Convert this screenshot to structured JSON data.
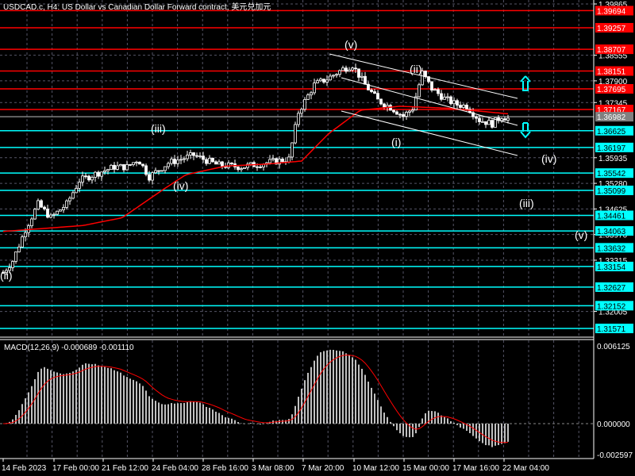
{
  "header": {
    "title": "USDCAD.c, H4:  US Dollar vs Canadian Dollar Forward contract, 美元兑加元"
  },
  "colors": {
    "resistance": "#ff0000",
    "support": "#00ffff",
    "current": "#808080",
    "ma": "#ff0000",
    "candle": "#ffffff",
    "histogram": "#c0c0c0",
    "signal": "#ff0000"
  },
  "chart_data": [
    {
      "type": "candlestick",
      "title": "USDCAD.c, H4",
      "ylim": [
        1.31571,
        1.39865
      ],
      "price_ticks": [
        "1.39865",
        "1.38555",
        "1.37900",
        "1.37345",
        "1.35935",
        "1.35280",
        "1.34625",
        "1.33970",
        "1.33315",
        "1.32005"
      ],
      "resistance_levels": [
        "1.39694",
        "1.39257",
        "1.38707",
        "1.38151",
        "1.37695",
        "1.37167"
      ],
      "current_price": "1.36982",
      "support_levels": [
        "1.36625",
        "1.36197",
        "1.35542",
        "1.35099",
        "1.34461",
        "1.34063",
        "1.33632",
        "1.33154",
        "1.32627",
        "1.32152",
        "1.31571"
      ],
      "close_keypoints": [
        [
          0,
          1.33
        ],
        [
          6,
          1.333
        ],
        [
          14,
          1.341
        ],
        [
          22,
          1.3475
        ],
        [
          30,
          1.344
        ],
        [
          40,
          1.3475
        ],
        [
          48,
          1.3535
        ],
        [
          58,
          1.3552
        ],
        [
          70,
          1.357
        ],
        [
          78,
          1.357
        ],
        [
          85,
          1.359
        ],
        [
          92,
          1.3545
        ],
        [
          104,
          1.358
        ],
        [
          120,
          1.36
        ],
        [
          135,
          1.3575
        ],
        [
          150,
          1.357
        ],
        [
          165,
          1.358
        ],
        [
          180,
          1.359
        ],
        [
          186,
          1.371
        ],
        [
          196,
          1.378
        ],
        [
          204,
          1.3795
        ],
        [
          214,
          1.382
        ],
        [
          220,
          1.383
        ],
        [
          228,
          1.378
        ],
        [
          236,
          1.374
        ],
        [
          245,
          1.372
        ],
        [
          252,
          1.37
        ],
        [
          258,
          1.372
        ],
        [
          264,
          1.381
        ],
        [
          270,
          1.377
        ],
        [
          278,
          1.3745
        ],
        [
          285,
          1.373
        ],
        [
          292,
          1.3725
        ],
        [
          300,
          1.369
        ],
        [
          308,
          1.368
        ],
        [
          314,
          1.37
        ],
        [
          320,
          1.369
        ]
      ],
      "ma_keypoints": [
        [
          0,
          1.3405
        ],
        [
          50,
          1.342
        ],
        [
          75,
          1.344
        ],
        [
          100,
          1.351
        ],
        [
          115,
          1.355
        ],
        [
          140,
          1.3572
        ],
        [
          165,
          1.3577
        ],
        [
          188,
          1.3585
        ],
        [
          205,
          1.3655
        ],
        [
          225,
          1.3715
        ],
        [
          250,
          1.3725
        ],
        [
          280,
          1.372
        ],
        [
          320,
          1.3705
        ]
      ],
      "time_labels": [
        "14 Feb 2023",
        "17 Feb 00:00",
        "21 Feb 12:00",
        "24 Feb 04:00",
        "28 Feb 16:00",
        "3 Mar 08:00",
        "7 Mar 20:00",
        "10 Mar 12:00",
        "15 Mar 00:00",
        "17 Mar 16:00",
        "22 Mar 04:00"
      ],
      "wave_labels": [
        "(v)",
        "(ii)",
        "(iii)",
        "(iv)",
        "(i)",
        "(ii)",
        "(iv)",
        "(iii)",
        "(v)"
      ]
    },
    {
      "type": "bar+line",
      "title": "MACD(12,26,9) -0.000689 -0.001110",
      "ylim": [
        -0.002597,
        0.006125
      ],
      "ticks": [
        "0.006125",
        "0.000000",
        "-0.002597"
      ],
      "series": [
        {
          "name": "MACD histogram"
        },
        {
          "name": "Signal"
        }
      ]
    }
  ]
}
